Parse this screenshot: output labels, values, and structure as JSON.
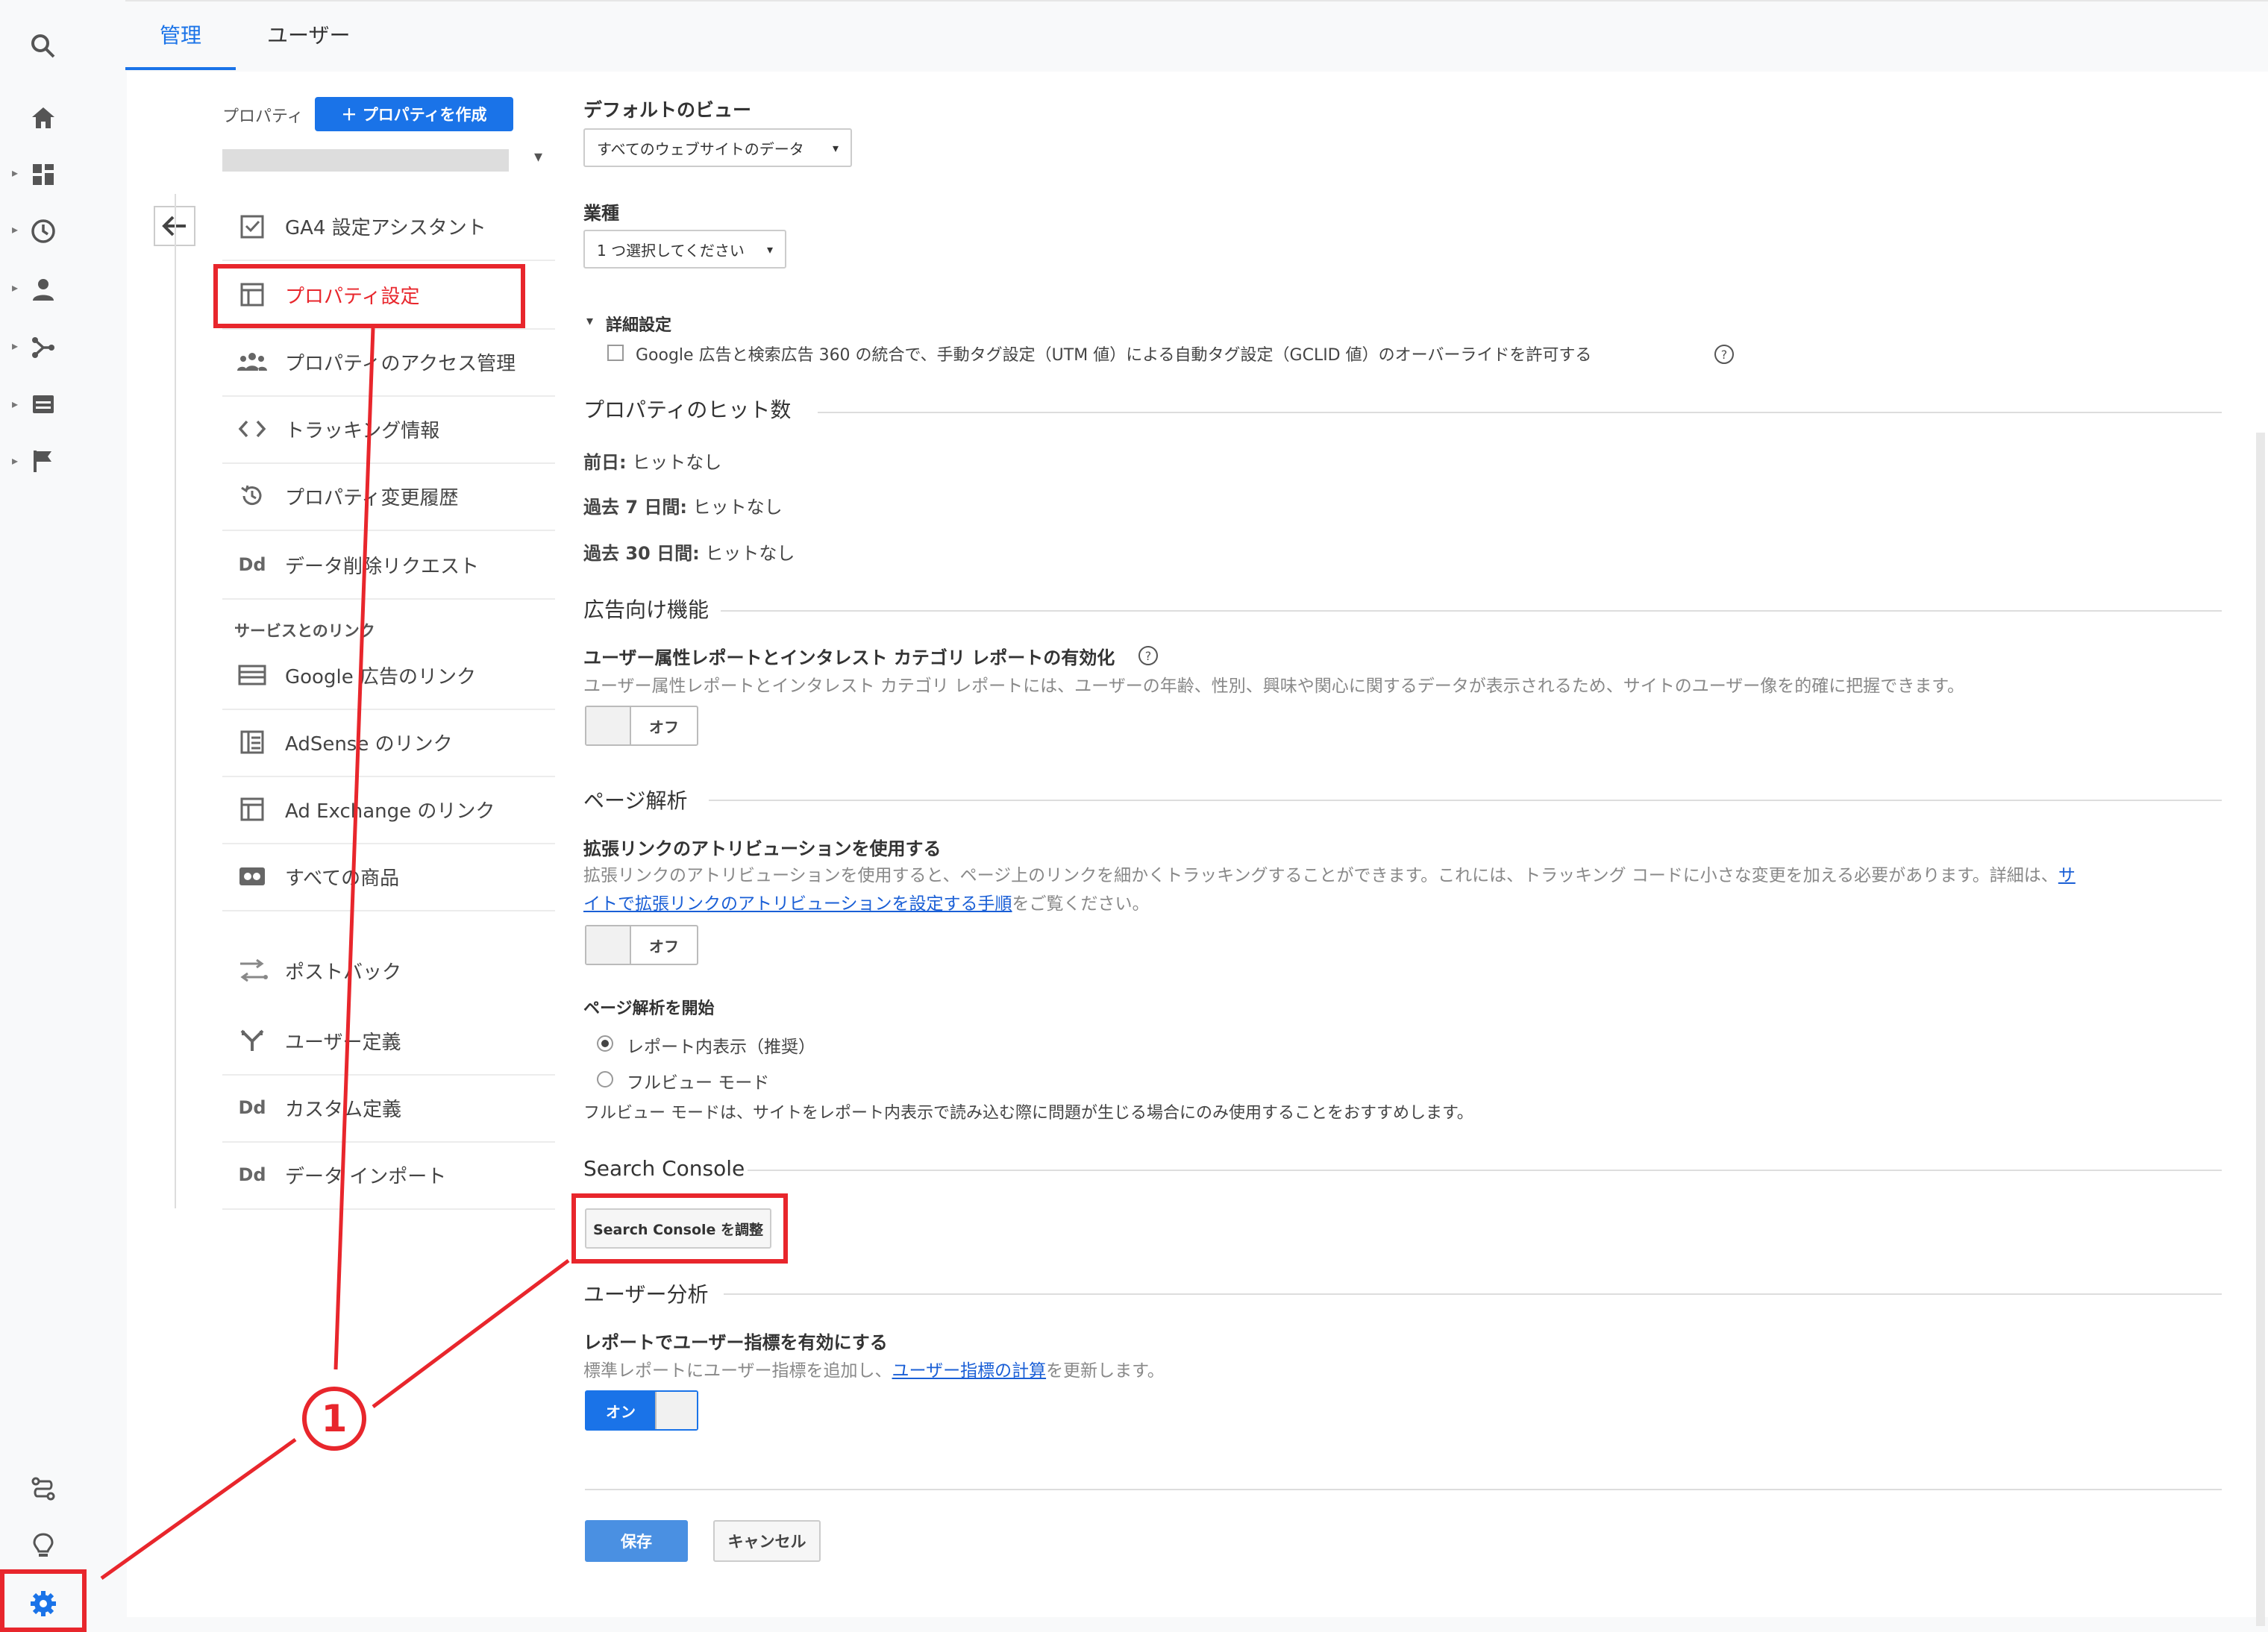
{
  "tabs": [
    {
      "label": "管理",
      "active": true
    },
    {
      "label": "ユーザー",
      "active": false
    }
  ],
  "rail_icons": [
    "search-icon",
    "home-icon",
    "dashboard-icon",
    "clock-icon",
    "person-icon",
    "acquisition-icon",
    "behavior-icon",
    "flag-icon",
    "attribution-icon",
    "lightbulb-icon",
    "gear-icon"
  ],
  "nav": {
    "property_label": "プロパティ",
    "create_property_button": "＋ プロパティを作成",
    "items": [
      {
        "label": "GA4 設定アシスタント",
        "icon": "checklist-icon"
      },
      {
        "label": "プロパティ設定",
        "icon": "property-settings-icon",
        "active": true
      },
      {
        "label": "プロパティのアクセス管理",
        "icon": "people-icon"
      },
      {
        "label": "トラッキング情報",
        "icon": "code-icon"
      },
      {
        "label": "プロパティ変更履歴",
        "icon": "history-icon"
      },
      {
        "label": "データ削除リクエスト",
        "icon": "dd-icon"
      }
    ],
    "links_header": "サービスとのリンク",
    "link_items": [
      {
        "label": "Google 広告のリンク",
        "icon": "ads-icon"
      },
      {
        "label": "AdSense のリンク",
        "icon": "adsense-icon"
      },
      {
        "label": "Ad Exchange のリンク",
        "icon": "adexchange-icon"
      },
      {
        "label": "すべての商品",
        "icon": "products-icon"
      },
      {
        "label": "ポストバック",
        "icon": "postback-icon"
      },
      {
        "label": "ユーザー定義",
        "icon": "user-definition-icon"
      },
      {
        "label": "カスタム定義",
        "icon": "dd-icon"
      },
      {
        "label": "データ インポート",
        "icon": "dd-icon"
      }
    ]
  },
  "settings": {
    "default_view_label": "デフォルトのビュー",
    "default_view_value": "すべてのウェブサイトのデータ",
    "industry_label": "業種",
    "industry_value": "1 つ選択してください",
    "advanced_label": "詳細設定",
    "advanced_checkbox": "Google 広告と検索広告 360 の統合で、手動タグ設定（UTM 値）による自動タグ設定（GCLID 値）のオーバーライドを許可する",
    "hits_title": "プロパティのヒット数",
    "hits": [
      {
        "label": "前日:",
        "value": "ヒットなし"
      },
      {
        "label": "過去 7 日間:",
        "value": "ヒットなし"
      },
      {
        "label": "過去 30 日間:",
        "value": "ヒットなし"
      }
    ],
    "ads_title": "広告向け機能",
    "demographics_label": "ユーザー属性レポートとインタレスト カテゴリ レポートの有効化",
    "demographics_desc": "ユーザー属性レポートとインタレスト カテゴリ レポートには、ユーザーの年齢、性別、興味や関心に関するデータが表示されるため、サイトのユーザー像を的確に把握できます。",
    "off_label": "オフ",
    "page_analytics_title": "ページ解析",
    "enhanced_link_label": "拡張リンクのアトリビューションを使用する",
    "enhanced_link_desc1": "拡張リンクのアトリビューションを使用すると、ページ上のリンクを細かくトラッキングすることができます。これには、トラッキング コードに小さな変更を加える必要があります。詳細は、",
    "enhanced_link_link1": "サ",
    "enhanced_link_link2": "イトで拡張リンクのアトリビューションを設定する手順",
    "enhanced_link_desc2": "をご覧ください。",
    "start_page_analytics_label": "ページ解析を開始",
    "radio_in_page": "レポート内表示（推奨）",
    "radio_full_view": "フルビュー モード",
    "full_view_note": "フルビュー モードは、サイトをレポート内表示で読み込む際に問題が生じる場合にのみ使用することをおすすめします。",
    "search_console_title": "Search Console",
    "search_console_button": "Search Console を調整",
    "user_analysis_title": "ユーザー分析",
    "user_metrics_label": "レポートでユーザー指標を有効にする",
    "user_metrics_desc1": "標準レポートにユーザー指標を追加し、",
    "user_metrics_link": "ユーザー指標の計算",
    "user_metrics_desc2": "を更新します。",
    "on_label": "オン",
    "save_button": "保存",
    "cancel_button": "キャンセル"
  },
  "annotation_number": "1",
  "colors": {
    "accent": "#1a73e8",
    "annotation_red": "#e8262c",
    "create_button": "#1a73e8"
  }
}
